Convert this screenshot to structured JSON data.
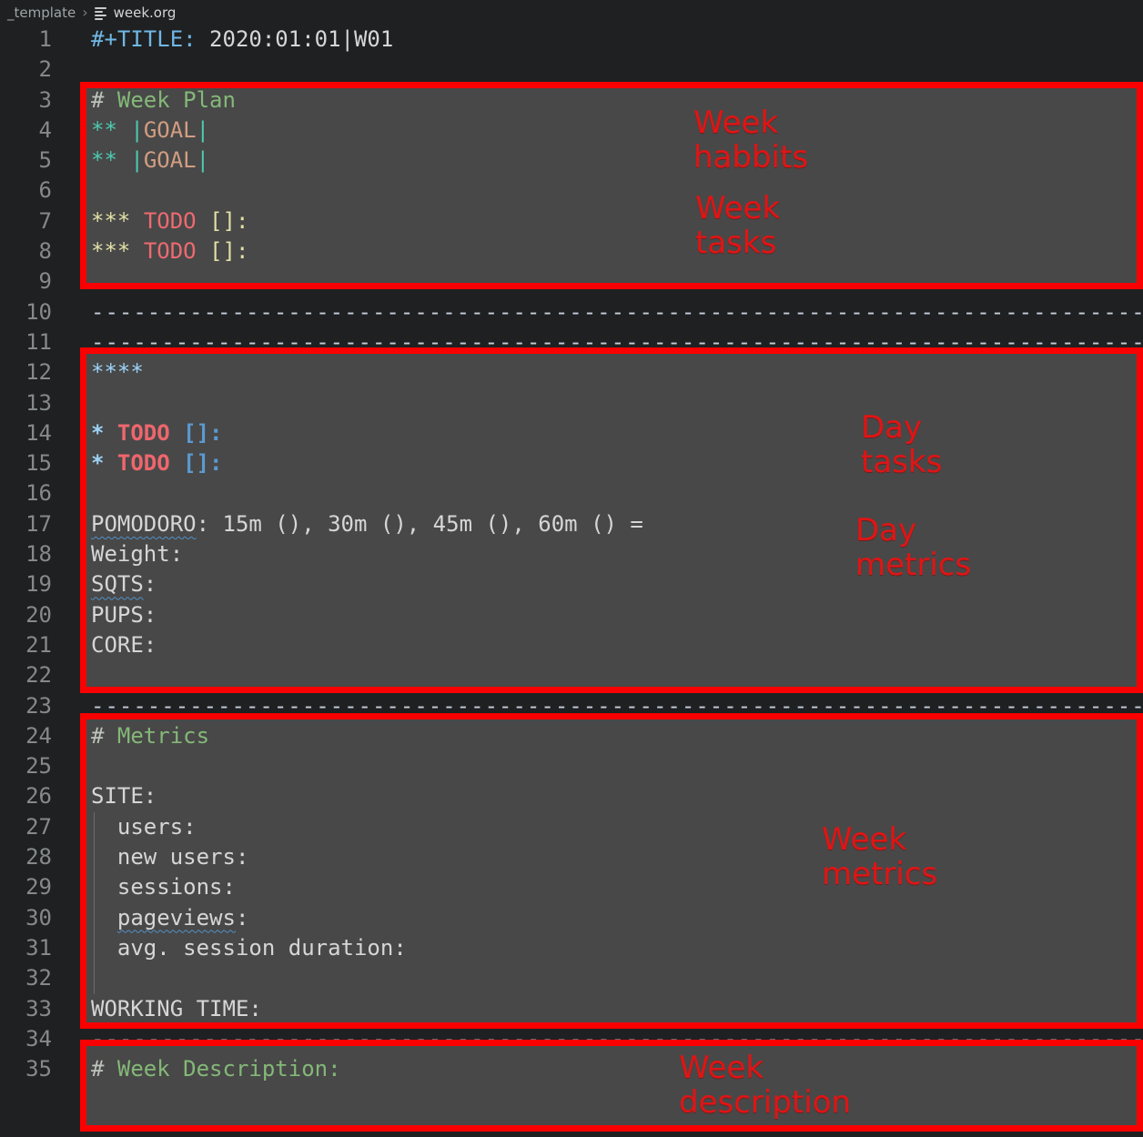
{
  "breadcrumb": {
    "folder": "_template",
    "separator": "›",
    "file": "week.org",
    "file_icon": "org-outline-icon"
  },
  "editor": {
    "colors": {
      "background": "#1e2021",
      "box_fill": "#484848",
      "annotation_border_red": "#fb0000",
      "annotation_label_red": "#e11414",
      "keyword_blue": "#70b7e5",
      "comment_green": "#84b878",
      "star_teal": "#4ec9b0",
      "goal_salmon": "#d29d82",
      "pale_yellow": "#e2dfa6",
      "todo_red": "#ef6a70",
      "light_blue": "#9cd2f7",
      "bracket_blue": "#5b9ad0",
      "text": "#d6d6d6",
      "line_number": "#85898c"
    },
    "lines": [
      {
        "n": "1",
        "parts": [
          {
            "t": "#+TITLE:",
            "c": "kw"
          },
          {
            "t": " 2020:01:01|W01",
            "c": "fg"
          }
        ]
      },
      {
        "n": "2",
        "parts": []
      },
      {
        "n": "3",
        "parts": [
          {
            "t": "#",
            "c": "hash"
          },
          {
            "t": " Week Plan",
            "c": "cm"
          }
        ]
      },
      {
        "n": "4",
        "parts": [
          {
            "t": "**",
            "c": "teal"
          },
          {
            "t": " ",
            "c": "fg"
          },
          {
            "t": "|",
            "c": "teal"
          },
          {
            "t": "GOAL",
            "c": "str"
          },
          {
            "t": "|",
            "c": "teal"
          }
        ]
      },
      {
        "n": "5",
        "parts": [
          {
            "t": "**",
            "c": "teal"
          },
          {
            "t": " ",
            "c": "fg"
          },
          {
            "t": "|",
            "c": "teal"
          },
          {
            "t": "GOAL",
            "c": "str"
          },
          {
            "t": "|",
            "c": "teal"
          }
        ]
      },
      {
        "n": "6",
        "parts": []
      },
      {
        "n": "7",
        "parts": [
          {
            "t": "***",
            "c": "yel"
          },
          {
            "t": " ",
            "c": "fg"
          },
          {
            "t": "TODO",
            "c": "red"
          },
          {
            "t": " ",
            "c": "fg"
          },
          {
            "t": "[]:",
            "c": "yel"
          }
        ]
      },
      {
        "n": "8",
        "parts": [
          {
            "t": "***",
            "c": "yel"
          },
          {
            "t": " ",
            "c": "fg"
          },
          {
            "t": "TODO",
            "c": "red"
          },
          {
            "t": " ",
            "c": "fg"
          },
          {
            "t": "[]:",
            "c": "yel"
          }
        ]
      },
      {
        "n": "9",
        "parts": []
      },
      {
        "n": "10",
        "parts": [
          {
            "t": "----------------------------------------------------------------------------------------",
            "c": "dash"
          }
        ]
      },
      {
        "n": "11",
        "parts": [
          {
            "t": "----------------------------------------------------------------------------------------",
            "c": "dash"
          }
        ]
      },
      {
        "n": "12",
        "parts": [
          {
            "t": "****",
            "c": "blue"
          }
        ]
      },
      {
        "n": "13",
        "parts": []
      },
      {
        "n": "14",
        "parts": [
          {
            "t": "*",
            "c": "blub"
          },
          {
            "t": " ",
            "c": "fg"
          },
          {
            "t": "TODO",
            "c": "redb"
          },
          {
            "t": " ",
            "c": "fg"
          },
          {
            "t": "[]:",
            "c": "bkt"
          }
        ]
      },
      {
        "n": "15",
        "parts": [
          {
            "t": "*",
            "c": "blub"
          },
          {
            "t": " ",
            "c": "fg"
          },
          {
            "t": "TODO",
            "c": "redb"
          },
          {
            "t": " ",
            "c": "fg"
          },
          {
            "t": "[]:",
            "c": "bkt"
          }
        ]
      },
      {
        "n": "16",
        "parts": []
      },
      {
        "n": "17",
        "parts": [
          {
            "t": "POMODORO",
            "c": "fg",
            "sq": true
          },
          {
            "t": ": 15m (), 30m (), 45m (), 60m () =",
            "c": "fg"
          }
        ]
      },
      {
        "n": "18",
        "parts": [
          {
            "t": "Weight:",
            "c": "fg"
          }
        ]
      },
      {
        "n": "19",
        "parts": [
          {
            "t": "SQTS",
            "c": "fg",
            "sq": true
          },
          {
            "t": ":",
            "c": "fg"
          }
        ]
      },
      {
        "n": "20",
        "parts": [
          {
            "t": "PUPS:",
            "c": "fg"
          }
        ]
      },
      {
        "n": "21",
        "parts": [
          {
            "t": "CORE:",
            "c": "fg"
          }
        ]
      },
      {
        "n": "22",
        "parts": []
      },
      {
        "n": "23",
        "parts": [
          {
            "t": "----------------------------------------------------------------------------------------",
            "c": "dash"
          }
        ]
      },
      {
        "n": "24",
        "parts": [
          {
            "t": "#",
            "c": "hash"
          },
          {
            "t": " Metrics",
            "c": "cm"
          }
        ]
      },
      {
        "n": "25",
        "parts": []
      },
      {
        "n": "26",
        "parts": [
          {
            "t": "SITE:",
            "c": "fg"
          }
        ]
      },
      {
        "n": "27",
        "parts": [
          {
            "t": "  users:",
            "c": "fg"
          }
        ]
      },
      {
        "n": "28",
        "parts": [
          {
            "t": "  new users:",
            "c": "fg"
          }
        ]
      },
      {
        "n": "29",
        "parts": [
          {
            "t": "  sessions:",
            "c": "fg"
          }
        ]
      },
      {
        "n": "30",
        "parts": [
          {
            "t": "  ",
            "c": "fg"
          },
          {
            "t": "pageviews",
            "c": "fg",
            "sq": true
          },
          {
            "t": ":",
            "c": "fg"
          }
        ]
      },
      {
        "n": "31",
        "parts": [
          {
            "t": "  avg. session duration:",
            "c": "fg"
          }
        ]
      },
      {
        "n": "32",
        "parts": []
      },
      {
        "n": "33",
        "parts": [
          {
            "t": "WORKING TIME:",
            "c": "fg"
          }
        ]
      },
      {
        "n": "34",
        "parts": [
          {
            "t": "----------------------------------------------------------------------------------------",
            "c": "dash"
          }
        ]
      },
      {
        "n": "35",
        "parts": [
          {
            "t": "#",
            "c": "hash"
          },
          {
            "t": " Week Description:",
            "c": "cm"
          }
        ]
      }
    ]
  },
  "annotations": {
    "labels": [
      {
        "id": "week-habbits",
        "text": "Week\nhabbits"
      },
      {
        "id": "week-tasks",
        "text": "Week\ntasks"
      },
      {
        "id": "day-tasks",
        "text": "Day\ntasks"
      },
      {
        "id": "day-metrics",
        "text": "Day\nmetrics"
      },
      {
        "id": "week-metrics",
        "text": "Week\nmetrics"
      },
      {
        "id": "week-description",
        "text": "Week\ndescription"
      }
    ],
    "boxes": [
      {
        "id": "week-plan-box"
      },
      {
        "id": "day-template-box"
      },
      {
        "id": "metrics-box"
      },
      {
        "id": "week-description-box"
      }
    ]
  }
}
